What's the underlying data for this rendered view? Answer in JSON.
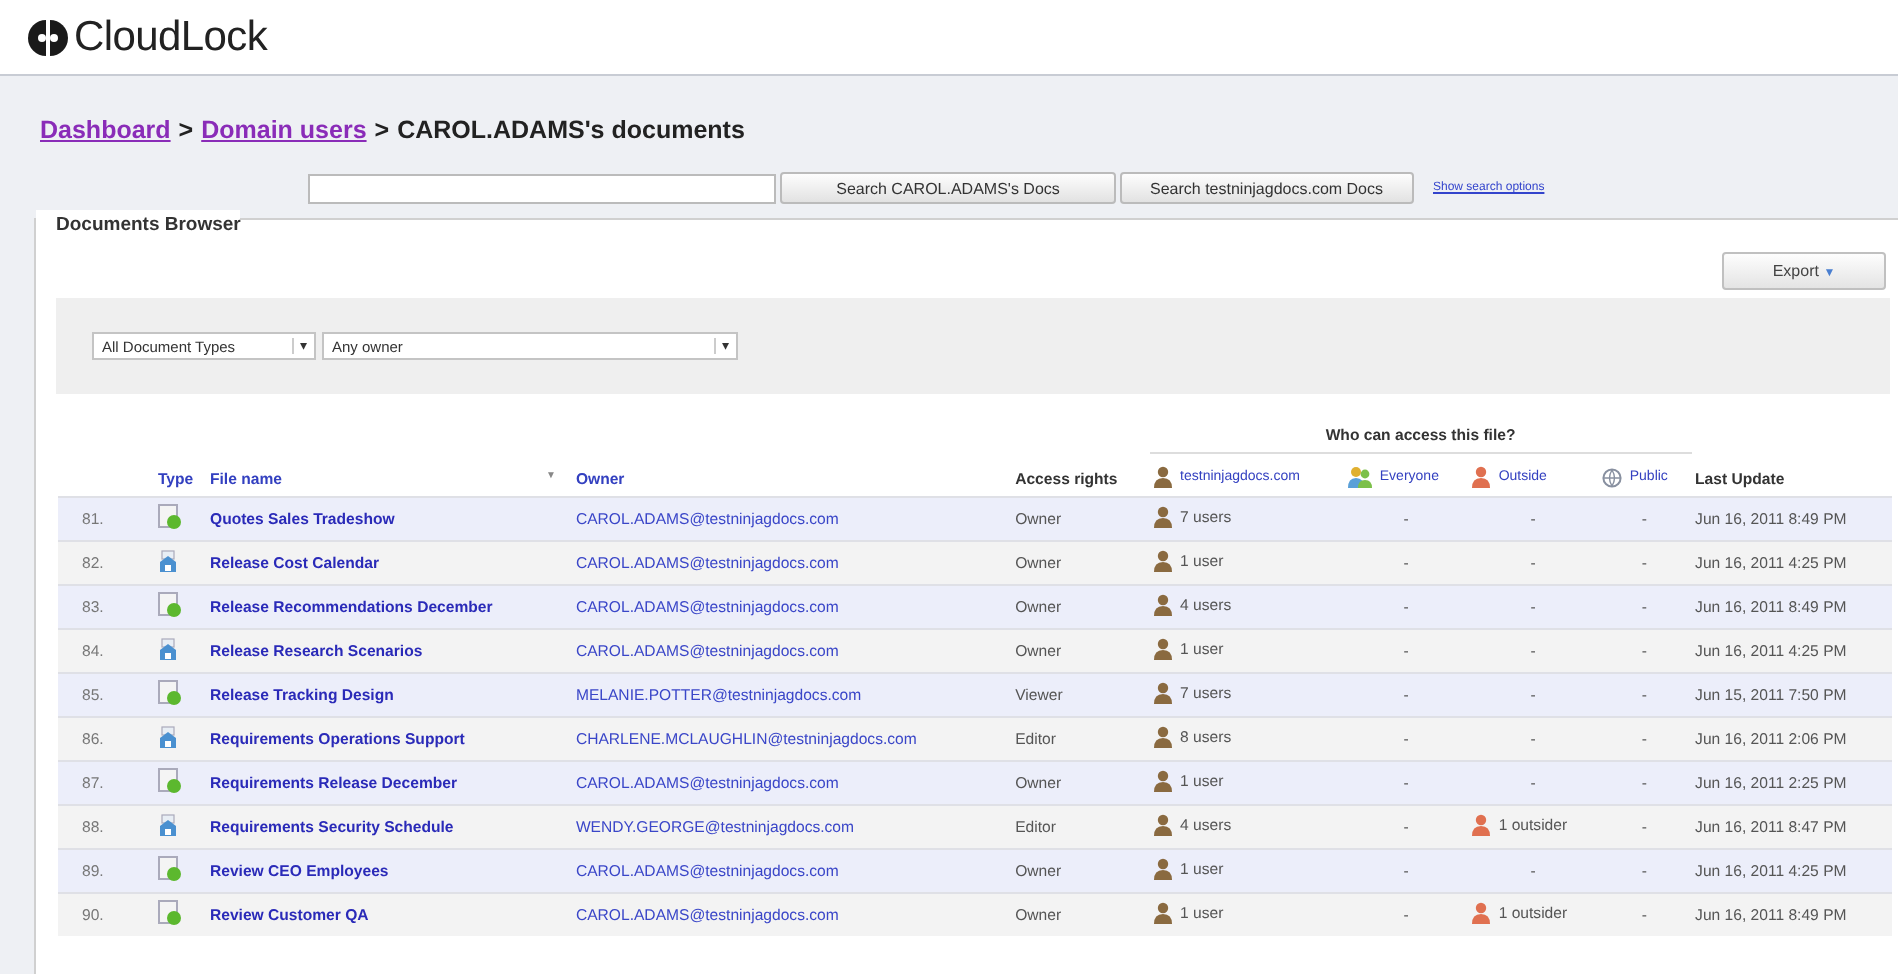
{
  "logo": {
    "text": "CloudLock"
  },
  "breadcrumb": {
    "links": [
      "Dashboard",
      "Domain users"
    ],
    "separator": ">",
    "current": "CAROL.ADAMS's documents"
  },
  "search": {
    "buttons": [
      "Search CAROL.ADAMS's Docs",
      "Search testninjagdocs.com Docs"
    ],
    "options_link": "Show search options"
  },
  "browser": {
    "title": "Documents Browser",
    "export_button": "Export",
    "caret": "▼",
    "filters": [
      {
        "value": "All Document Types",
        "arrow": "▾",
        "kind": "short"
      },
      {
        "value": "Any owner",
        "arrow": "▾",
        "kind": "long"
      }
    ]
  },
  "table": {
    "group_heading": "Who can access this file?",
    "columns": [
      {
        "label": "Type",
        "kind": "link"
      },
      {
        "label": "File name",
        "kind": "sortable",
        "sort_mark": "▼"
      },
      {
        "label": "Owner",
        "kind": "link"
      },
      {
        "label": "Access rights",
        "kind": "plain"
      },
      {
        "label": "testninjagdocs.com",
        "kind": "domain"
      },
      {
        "label": "Everyone",
        "kind": "everyone"
      },
      {
        "label": "Outside",
        "kind": "outside"
      },
      {
        "label": "Public",
        "kind": "public"
      },
      {
        "label": "Last Update",
        "kind": "plain"
      }
    ],
    "rows": [
      {
        "num": "81.",
        "kind": "sheet",
        "name": "Quotes Sales Tradeshow",
        "owner": "CAROL.ADAMS@testninjagdocs.com",
        "rights": "Owner",
        "domain": "7 users",
        "everyone": "-",
        "outside": "-",
        "outside_icon": false,
        "public": "-",
        "updated": "Jun 16, 2011 8:49 PM"
      },
      {
        "num": "82.",
        "kind": "doc",
        "name": "Release Cost Calendar",
        "owner": "CAROL.ADAMS@testninjagdocs.com",
        "rights": "Owner",
        "domain": "1 user",
        "everyone": "-",
        "outside": "-",
        "outside_icon": false,
        "public": "-",
        "updated": "Jun 16, 2011 4:25 PM"
      },
      {
        "num": "83.",
        "kind": "sheet",
        "name": "Release Recommendations December",
        "owner": "CAROL.ADAMS@testninjagdocs.com",
        "rights": "Owner",
        "domain": "4 users",
        "everyone": "-",
        "outside": "-",
        "outside_icon": false,
        "public": "-",
        "updated": "Jun 16, 2011 8:49 PM"
      },
      {
        "num": "84.",
        "kind": "doc",
        "name": "Release Research Scenarios",
        "owner": "CAROL.ADAMS@testninjagdocs.com",
        "rights": "Owner",
        "domain": "1 user",
        "everyone": "-",
        "outside": "-",
        "outside_icon": false,
        "public": "-",
        "updated": "Jun 16, 2011 4:25 PM"
      },
      {
        "num": "85.",
        "kind": "sheet",
        "name": "Release Tracking Design",
        "owner": "MELANIE.POTTER@testninjagdocs.com",
        "rights": "Viewer",
        "domain": "7 users",
        "everyone": "-",
        "outside": "-",
        "outside_icon": false,
        "public": "-",
        "updated": "Jun 15, 2011 7:50 PM"
      },
      {
        "num": "86.",
        "kind": "doc",
        "name": "Requirements Operations Support",
        "owner": "CHARLENE.MCLAUGHLIN@testninjagdocs.com",
        "rights": "Editor",
        "domain": "8 users",
        "everyone": "-",
        "outside": "-",
        "outside_icon": false,
        "public": "-",
        "updated": "Jun 16, 2011 2:06 PM"
      },
      {
        "num": "87.",
        "kind": "sheet",
        "name": "Requirements Release December",
        "owner": "CAROL.ADAMS@testninjagdocs.com",
        "rights": "Owner",
        "domain": "1 user",
        "everyone": "-",
        "outside": "-",
        "outside_icon": false,
        "public": "-",
        "updated": "Jun 16, 2011 2:25 PM"
      },
      {
        "num": "88.",
        "kind": "doc",
        "name": "Requirements Security Schedule",
        "owner": "WENDY.GEORGE@testninjagdocs.com",
        "rights": "Editor",
        "domain": "4 users",
        "everyone": "-",
        "outside": "1 outsider",
        "outside_icon": true,
        "public": "-",
        "updated": "Jun 16, 2011 8:47 PM"
      },
      {
        "num": "89.",
        "kind": "sheet",
        "name": "Review CEO Employees",
        "owner": "CAROL.ADAMS@testninjagdocs.com",
        "rights": "Owner",
        "domain": "1 user",
        "everyone": "-",
        "outside": "-",
        "outside_icon": false,
        "public": "-",
        "updated": "Jun 16, 2011 4:25 PM"
      },
      {
        "num": "90.",
        "kind": "sheet",
        "name": "Review Customer QA",
        "owner": "CAROL.ADAMS@testninjagdocs.com",
        "rights": "Owner",
        "domain": "1 user",
        "everyone": "-",
        "outside": "1 outsider",
        "outside_icon": true,
        "public": "-",
        "updated": "Jun 16, 2011 8:49 PM"
      }
    ]
  }
}
